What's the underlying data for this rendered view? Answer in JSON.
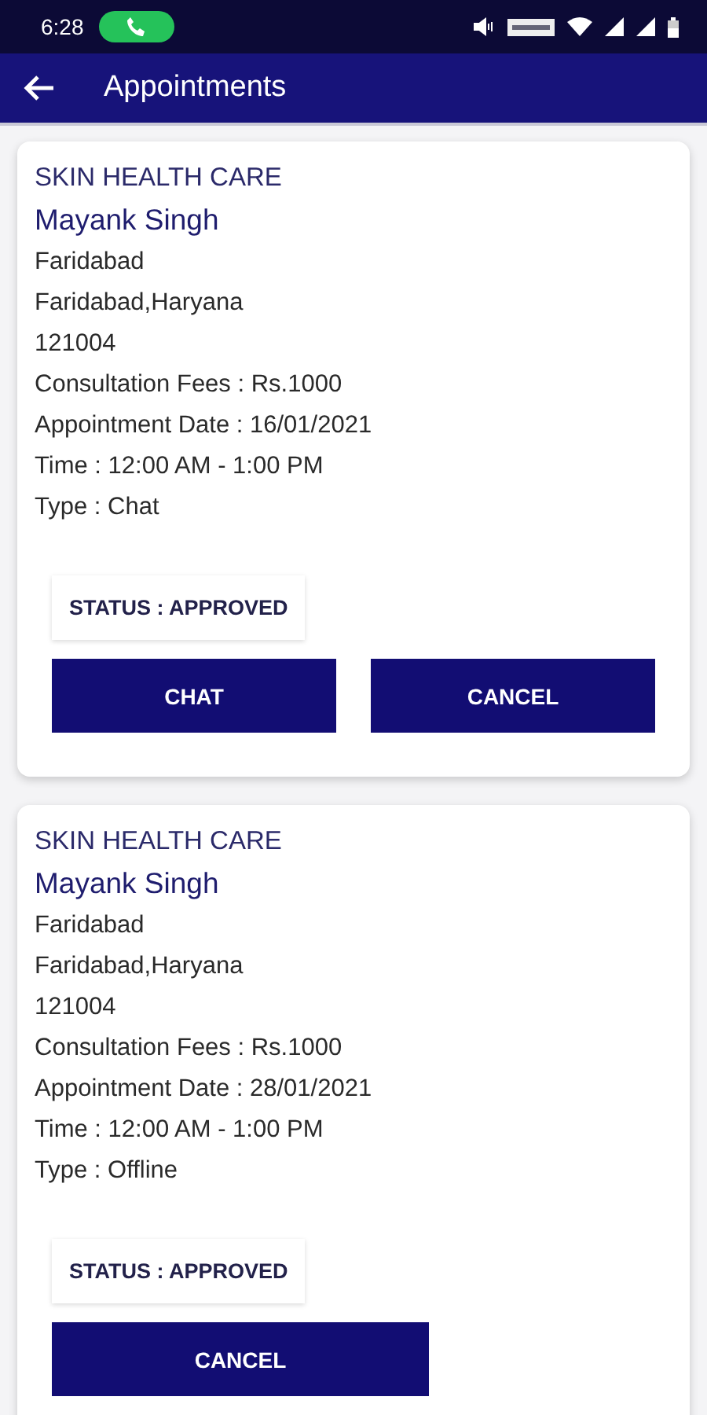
{
  "status_bar": {
    "time": "6:28"
  },
  "app_bar": {
    "title": "Appointments"
  },
  "appointments": [
    {
      "clinic": "SKIN HEALTH CARE",
      "doctor": "Mayank Singh",
      "lines": [
        "Faridabad",
        "Faridabad,Haryana",
        "121004",
        "Consultation Fees : Rs.1000",
        "Appointment Date : 16/01/2021",
        "Time : 12:00 AM - 1:00 PM",
        "Type : Chat"
      ],
      "status": "STATUS : APPROVED",
      "actions": [
        "CHAT",
        "CANCEL"
      ]
    },
    {
      "clinic": "SKIN HEALTH CARE",
      "doctor": "Mayank Singh",
      "lines": [
        "Faridabad",
        "Faridabad,Haryana",
        "121004",
        "Consultation Fees : Rs.1000",
        "Appointment Date : 28/01/2021",
        "Time : 12:00 AM - 1:00 PM",
        "Type : Offline"
      ],
      "status": "STATUS : APPROVED",
      "actions": [
        "CANCEL"
      ]
    }
  ]
}
